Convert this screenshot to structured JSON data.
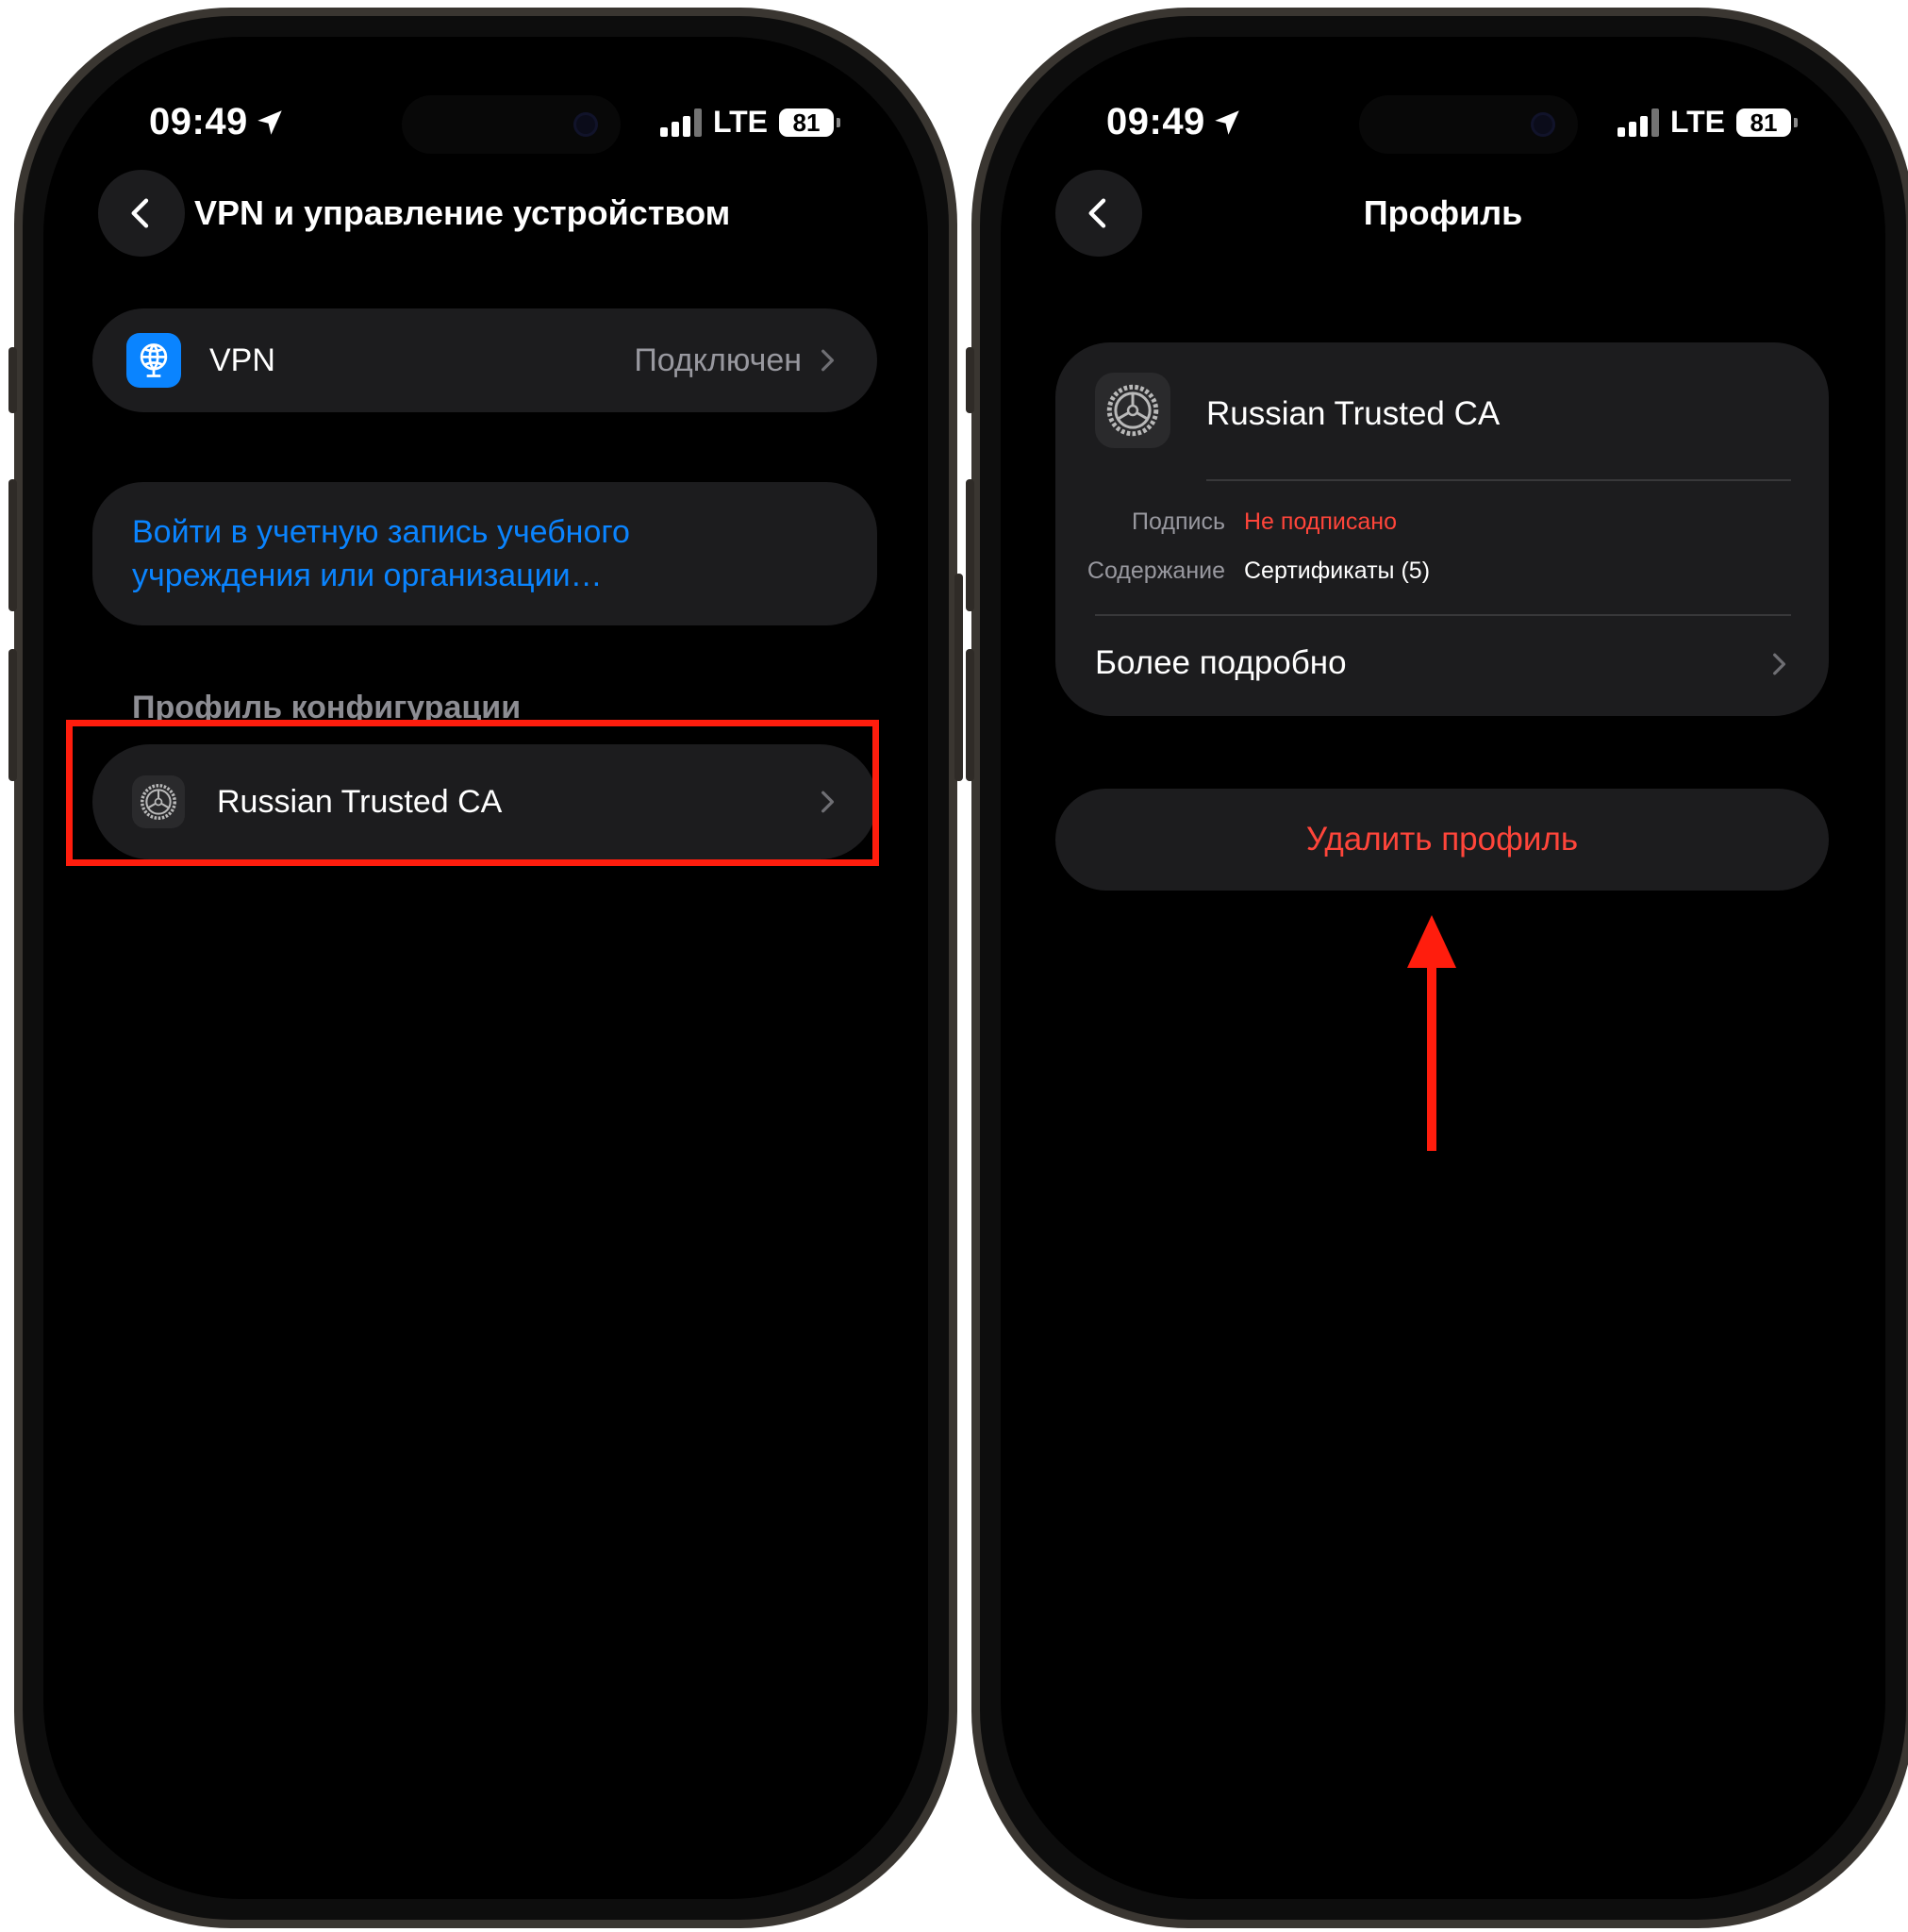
{
  "status_bar": {
    "time": "09:49",
    "network": "LTE",
    "battery": "81"
  },
  "left": {
    "nav_title": "VPN и управление устройством",
    "vpn": {
      "label": "VPN",
      "value": "Подключен"
    },
    "signin_link": "Войти в учетную запись учебного учреждения или организации…",
    "section_header": "Профиль конфигурации",
    "profile_row": "Russian Trusted CA"
  },
  "right": {
    "nav_title": "Профиль",
    "profile_name": "Russian Trusted CA",
    "signature_label": "Подпись",
    "signature_value": "Не подписано",
    "contents_label": "Содержание",
    "contents_value": "Сертификаты (5)",
    "more_details": "Более подробно",
    "remove_profile": "Удалить профиль"
  },
  "colors": {
    "accent_blue": "#0a84ff",
    "destructive_red": "#ff453a",
    "annotation_red": "#ff1d0d",
    "cell_bg": "#1c1c1e"
  },
  "icons": [
    "location-arrow-icon",
    "chevron-left-icon",
    "vpn-globe-icon",
    "gear-icon",
    "chevron-right-icon",
    "arrow-up-annotation"
  ]
}
